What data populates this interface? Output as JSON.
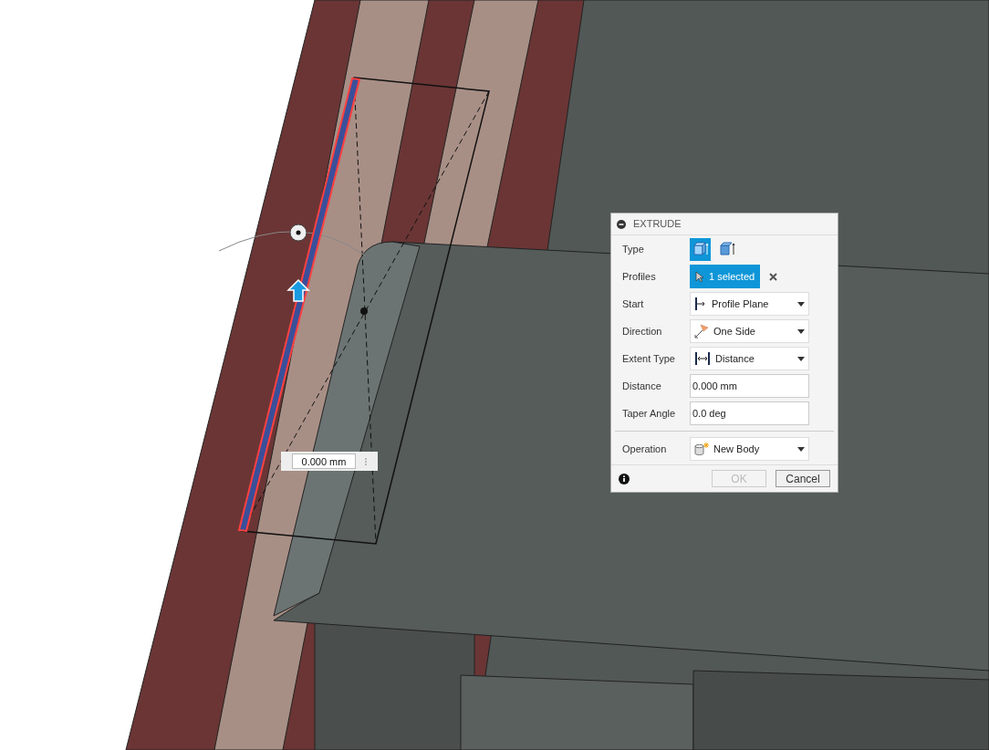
{
  "floating_input": {
    "value": "0.000 mm"
  },
  "dialog": {
    "title": "EXTRUDE",
    "type": {
      "label": "Type",
      "options": [
        {
          "kind": "solid",
          "selected": true
        },
        {
          "kind": "thin",
          "selected": false
        }
      ]
    },
    "profiles": {
      "label": "Profiles",
      "value": "1 selected"
    },
    "rows": [
      {
        "kind": "dropdown",
        "label": "Start",
        "value": "Profile Plane"
      },
      {
        "kind": "dropdown",
        "label": "Direction",
        "value": "One Side"
      },
      {
        "kind": "dropdown",
        "label": "Extent Type",
        "value": "Distance"
      },
      {
        "kind": "input",
        "label": "Distance",
        "value": "0.000 mm"
      },
      {
        "kind": "input",
        "label": "Taper Angle",
        "value": "0.0 deg"
      }
    ],
    "operation": {
      "label": "Operation",
      "value": "New Body"
    },
    "buttons": [
      {
        "label": "OK",
        "disabled": true
      },
      {
        "label": "Cancel",
        "disabled": false
      }
    ]
  }
}
